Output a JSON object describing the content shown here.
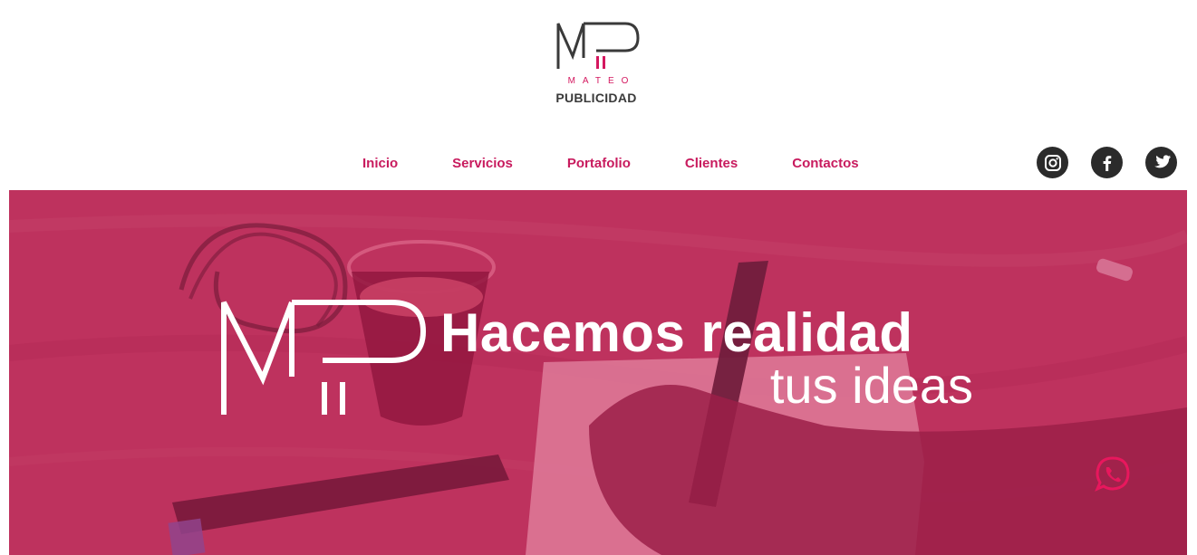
{
  "brand": {
    "logo_sub": "MATEO",
    "logo_main": "PUBLICIDAD",
    "accent_color": "#d4175f",
    "dark_color": "#3a3a3a"
  },
  "nav": {
    "items": [
      {
        "label": "Inicio"
      },
      {
        "label": "Servicios"
      },
      {
        "label": "Portafolio"
      },
      {
        "label": "Clientes"
      },
      {
        "label": "Contactos"
      }
    ]
  },
  "social": {
    "icons": [
      "instagram-icon",
      "facebook-icon",
      "twitter-icon"
    ]
  },
  "hero": {
    "title": "Hacemos realidad",
    "subtitle": "tus ideas",
    "overlay_color": "#c0325d"
  },
  "whatsapp": {
    "icon": "whatsapp-icon",
    "color": "#e8175d"
  }
}
